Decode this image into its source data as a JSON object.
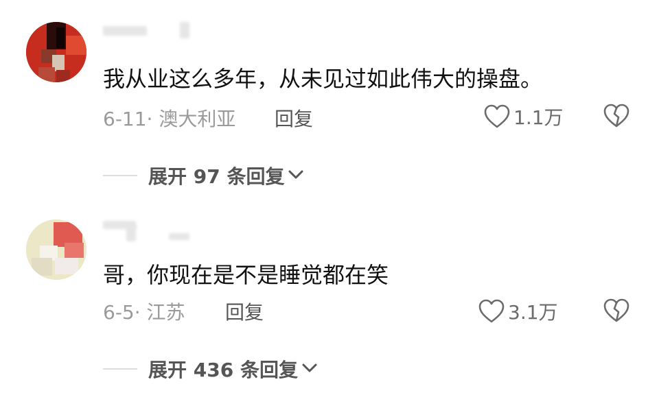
{
  "comments": [
    {
      "text": "我从业这么多年，从未见过如此伟大的操盘。",
      "meta": "6-11· 澳大利亚",
      "reply_label": "回复",
      "likes": "1.1万",
      "expand": {
        "label": "展开 97 条回复"
      }
    },
    {
      "text": "哥，你现在是不是睡觉都在笑",
      "meta": "6-5· 江苏",
      "reply_label": "回复",
      "likes": "3.1万",
      "expand": {
        "label": "展开 436 条回复"
      }
    }
  ],
  "icons": {
    "like": "heart-outline-icon",
    "dislike": "broken-heart-icon",
    "expand": "chevron-down-icon"
  },
  "colors": {
    "text": "#111111",
    "meta": "#9a9a9a",
    "action": "#555555"
  }
}
